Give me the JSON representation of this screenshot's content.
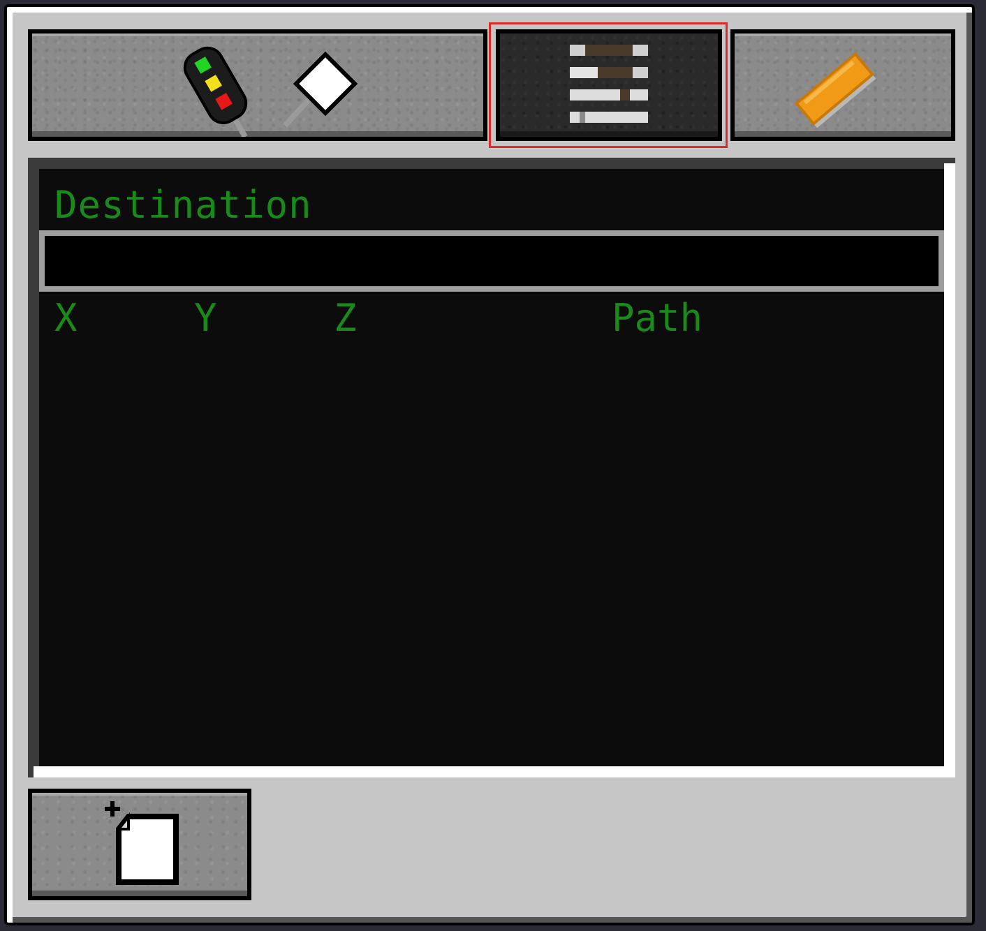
{
  "tabs": [
    {
      "name": "signals",
      "icon": "signal-icon",
      "active": false
    },
    {
      "name": "schedule",
      "icon": "track-list-icon",
      "active": true
    },
    {
      "name": "ruler",
      "icon": "ruler-icon",
      "active": false
    }
  ],
  "destination": {
    "label": "Destination",
    "value": "",
    "placeholder": ""
  },
  "table": {
    "columns": [
      "X",
      "Y",
      "Z",
      "Path"
    ],
    "rows": []
  },
  "add_button": {
    "icon": "new-document-icon"
  },
  "colors": {
    "text_green": "#1a8a1a",
    "highlight": "#e02a2a",
    "panel_bg": "#c6c6c6"
  }
}
